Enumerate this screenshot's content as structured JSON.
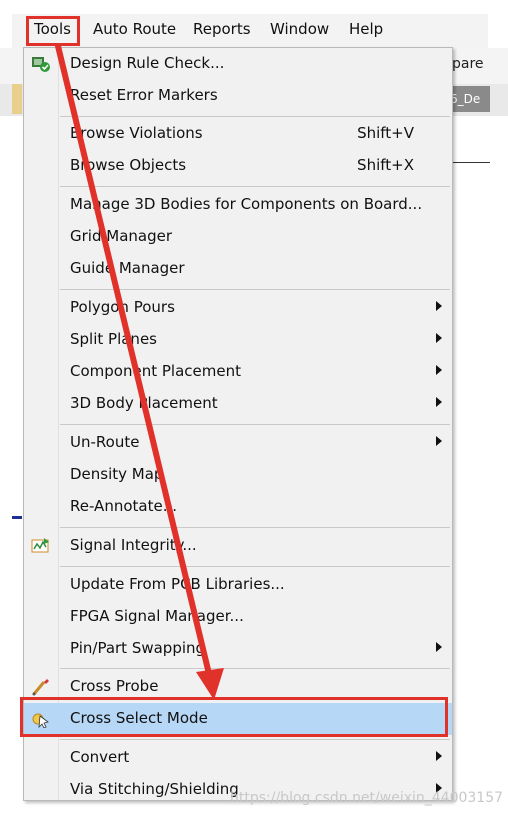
{
  "menubar": {
    "items": [
      "Tools",
      "Auto Route",
      "Reports",
      "Window",
      "Help"
    ]
  },
  "background": {
    "toolbar_text": "pare",
    "tab_text": "6_De"
  },
  "menu": {
    "design_rule_check": "Design Rule Check...",
    "reset_error_markers": "Reset Error Markers",
    "browse_violations": "Browse Violations",
    "browse_violations_shortcut": "Shift+V",
    "browse_objects": "Browse Objects",
    "browse_objects_shortcut": "Shift+X",
    "manage_3d_bodies": "Manage 3D Bodies for Components on Board...",
    "grid_manager": "Grid Manager",
    "guide_manager": "Guide Manager",
    "polygon_pours": "Polygon Pours",
    "split_planes": "Split Planes",
    "component_placement": "Component Placement",
    "body_placement_3d": "3D Body Placement",
    "un_route": "Un-Route",
    "density_map": "Density Map",
    "re_annotate": "Re-Annotate...",
    "signal_integrity": "Signal Integrity...",
    "update_from_pcb_libraries": "Update From PCB Libraries...",
    "fpga_signal_manager": "FPGA Signal Manager...",
    "pin_part_swapping": "Pin/Part Swapping",
    "cross_probe": "Cross Probe",
    "cross_select_mode": "Cross Select Mode",
    "convert": "Convert",
    "via_stitching_shielding": "Via Stitching/Shielding"
  },
  "icons": {
    "drc": "drc-check-icon",
    "signal_integrity": "signal-integrity-icon",
    "cross_probe": "cross-probe-icon",
    "cross_select": "cross-select-icon",
    "submenu": "submenu-arrow-icon"
  },
  "colors": {
    "highlight": "#b7d7f6",
    "annotation_red": "#e0322b"
  },
  "watermark": "https://blog.csdn.net/weixin_44003157"
}
